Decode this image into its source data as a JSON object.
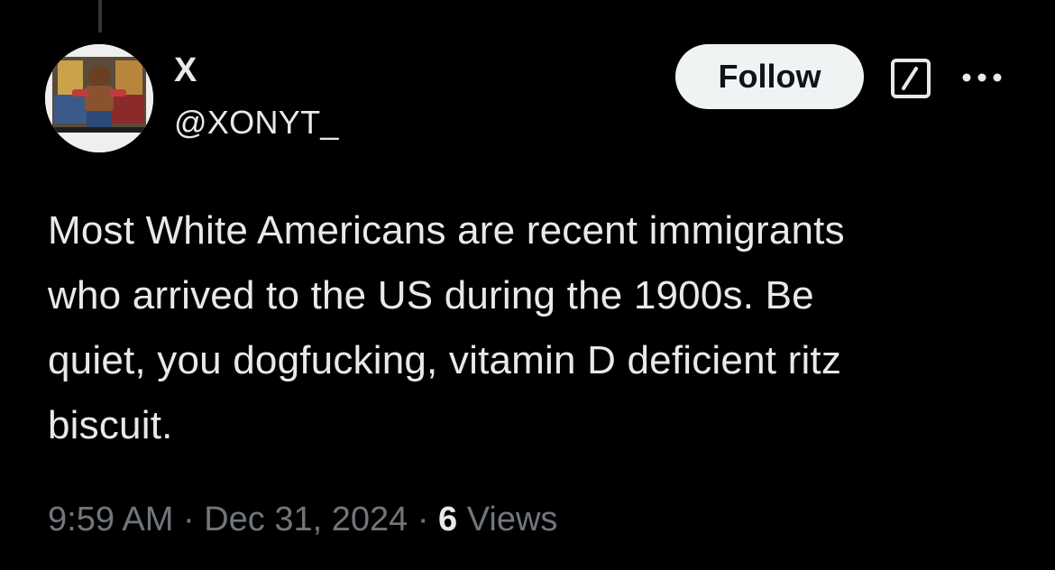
{
  "author": {
    "display_name": "X",
    "handle": "@XONYT_",
    "avatar_icon": "profile-photo"
  },
  "actions": {
    "follow_label": "Follow",
    "grok_icon": "grok-icon",
    "more_icon": "more-icon"
  },
  "tweet": {
    "lines": [
      "Most White Americans are recent immigrants",
      "who arrived to the US during the 1900s. Be",
      "quiet, you dogfucking, vitamin D deficient ritz",
      "biscuit."
    ]
  },
  "meta": {
    "time": "9:59 AM",
    "separator": "·",
    "date": "Dec 31, 2024",
    "views_count": "6",
    "views_label": "Views"
  },
  "colors": {
    "background": "#000000",
    "text_primary": "#e7e9ea",
    "text_secondary": "#71767b",
    "follow_bg": "#eff3f4"
  }
}
